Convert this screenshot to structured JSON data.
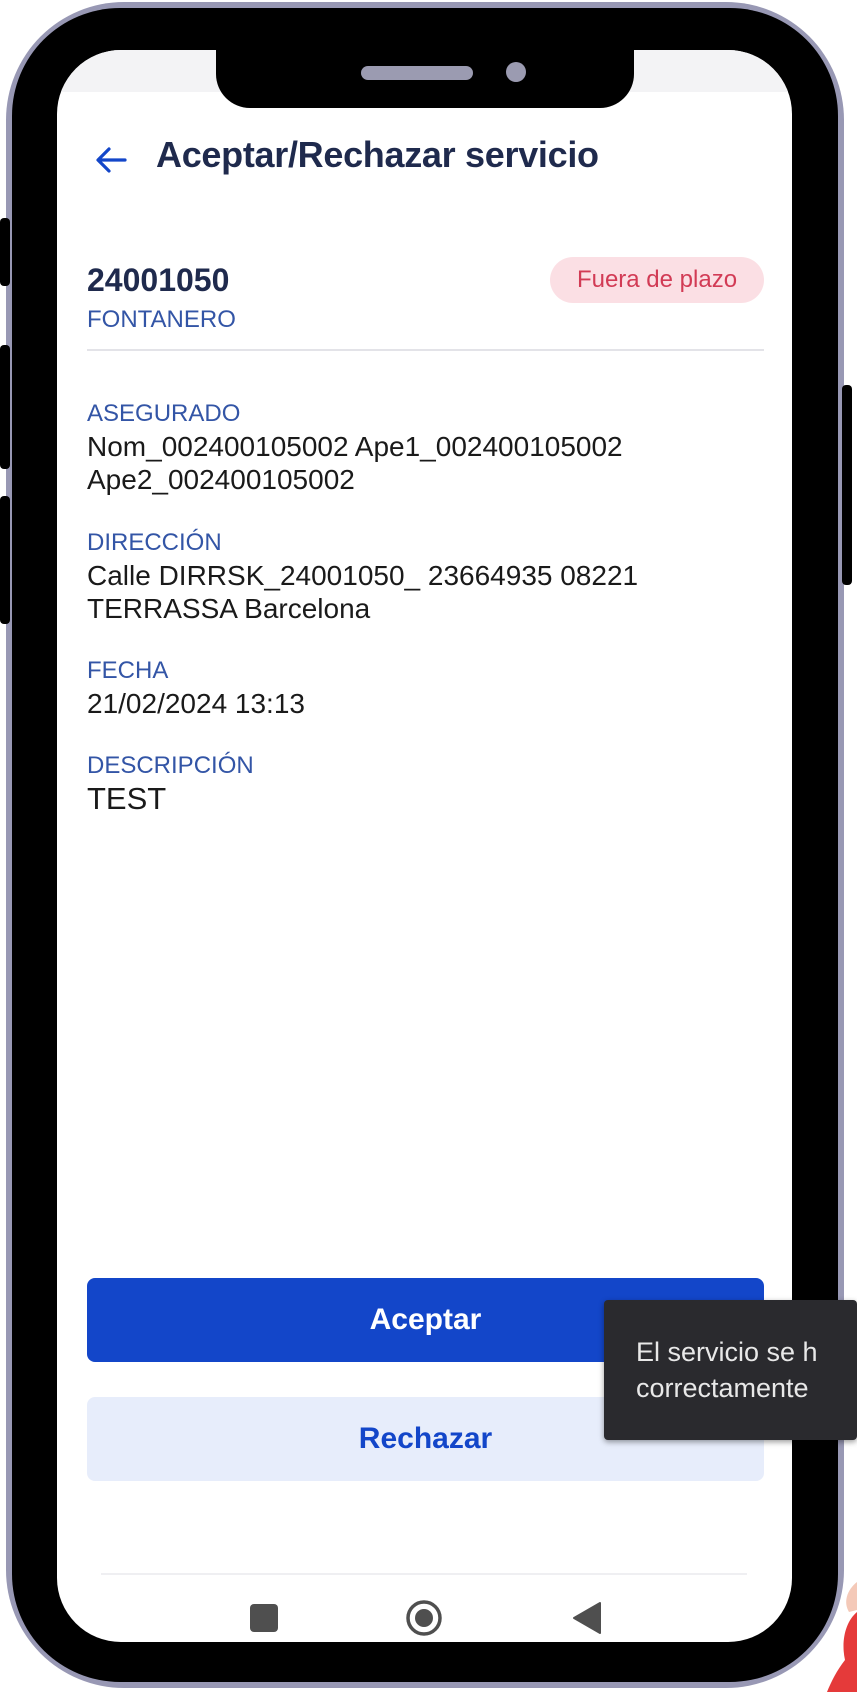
{
  "header": {
    "title": "Aceptar/Rechazar servicio",
    "back_icon": "arrow-left-icon"
  },
  "service": {
    "id": "24001050",
    "type": "FONTANERO",
    "status": "Fuera de plazo"
  },
  "fields": {
    "asegurado": {
      "label": "ASEGURADO",
      "value": "Nom_002400105002 Ape1_002400105002 Ape2_002400105002"
    },
    "direccion": {
      "label": "DIRECCIÓN",
      "value": "Calle DIRRSK_24001050_ 23664935 08221 TERRASSA Barcelona"
    },
    "fecha": {
      "label": "FECHA",
      "value": "21/02/2024 13:13"
    },
    "descripcion": {
      "label": "DESCRIPCIÓN",
      "value": "TEST"
    }
  },
  "actions": {
    "accept_label": "Aceptar",
    "reject_label": "Rechazar"
  },
  "toast": {
    "line1": "El servicio se h",
    "line2": "correctamente"
  },
  "navbar": {
    "icons": [
      "recents-square-icon",
      "home-circle-icon",
      "back-triangle-icon"
    ]
  },
  "colors": {
    "primary": "#1346c9",
    "primary_light": "#e7edfb",
    "title": "#1f2a4d",
    "label": "#3355a6",
    "badge_bg": "#fbdfe4",
    "badge_text": "#d23b55",
    "frame": "#9898b4"
  }
}
